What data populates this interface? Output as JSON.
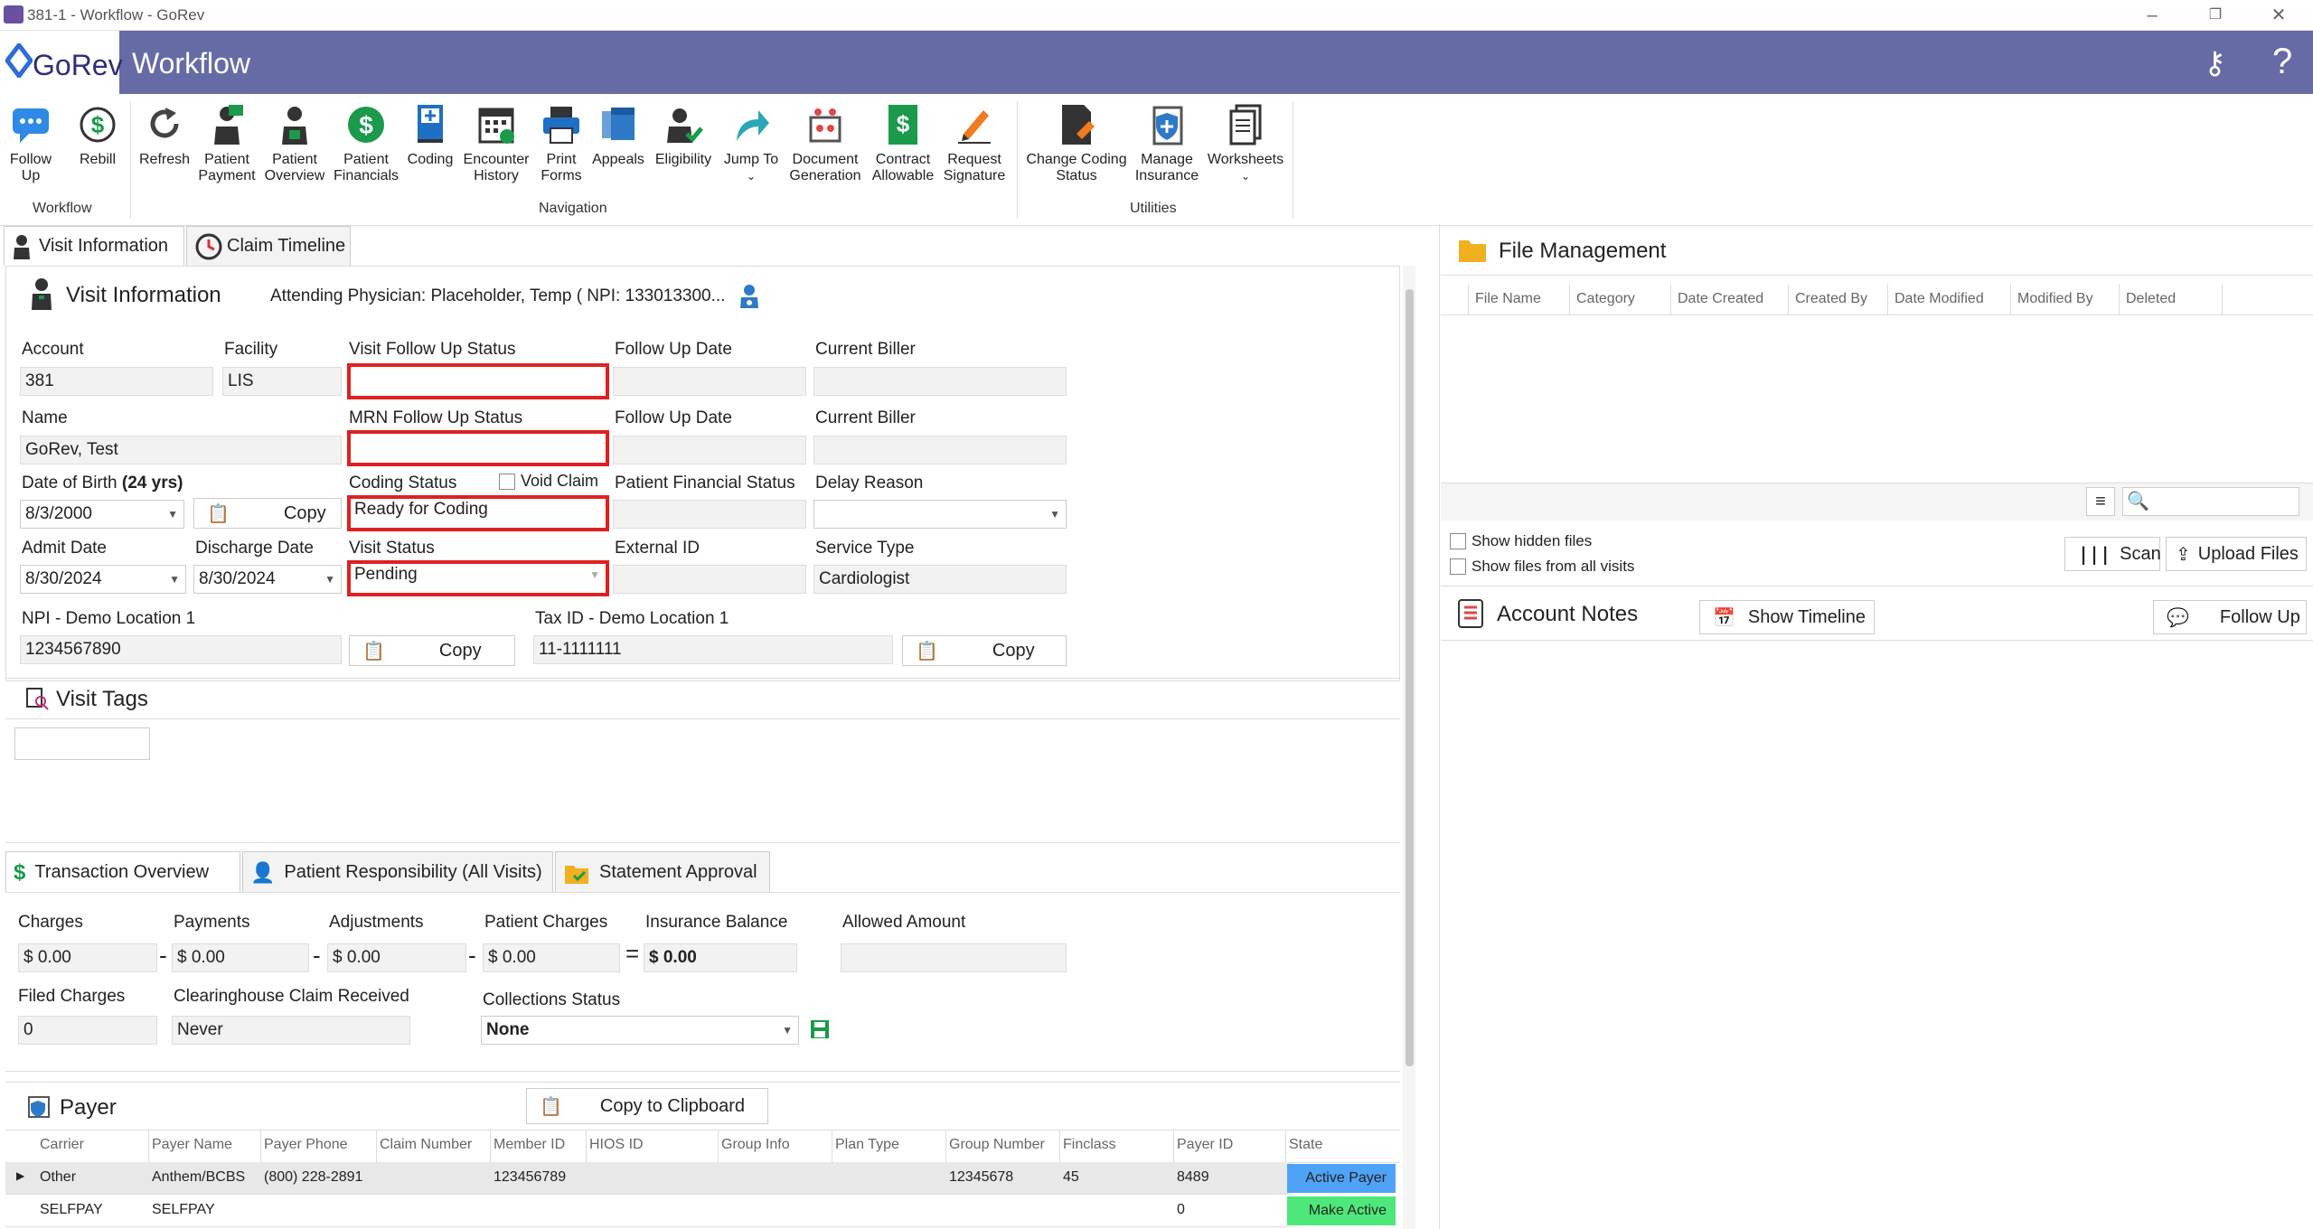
{
  "window": {
    "title": "381-1 - Workflow - GoRev"
  },
  "header": {
    "brand": "GoRev",
    "title": "Workflow"
  },
  "ribbon": {
    "groups": {
      "workflow": "Workflow",
      "navigation": "Navigation",
      "utilities": "Utilities"
    },
    "buttons": {
      "follow_up": "Follow Up",
      "rebill": "Rebill",
      "refresh": "Refresh",
      "patient_payment": "Patient Payment",
      "patient_overview": "Patient Overview",
      "patient_financials": "Patient Financials",
      "coding": "Coding",
      "encounter_history": "Encounter History",
      "print_forms": "Print Forms",
      "appeals": "Appeals",
      "eligibility": "Eligibility",
      "jump_to": "Jump To",
      "document_generation": "Document Generation",
      "contract_allowable": "Contract Allowable",
      "request_signature": "Request Signature",
      "change_coding_status": "Change Coding Status",
      "manage_insurance": "Manage Insurance",
      "worksheets": "Worksheets"
    }
  },
  "tabs": {
    "visit_information": "Visit Information",
    "claim_timeline": "Claim Timeline"
  },
  "visit": {
    "title": "Visit Information",
    "attending": "Attending Physician: Placeholder, Temp ( NPI: 133013300...",
    "labels": {
      "account": "Account",
      "facility": "Facility",
      "visit_follow_up_status": "Visit Follow Up Status",
      "follow_up_date": "Follow Up Date",
      "current_biller": "Current Biller",
      "name": "Name",
      "mrn_follow_up_status": "MRN Follow Up Status",
      "dob": "Date of Birth",
      "dob_age": "(24 yrs)",
      "coding_status": "Coding Status",
      "void_claim": "Void Claim",
      "patient_financial_status": "Patient Financial Status",
      "delay_reason": "Delay Reason",
      "admit_date": "Admit Date",
      "discharge_date": "Discharge Date",
      "visit_status": "Visit Status",
      "external_id": "External ID",
      "service_type": "Service Type",
      "npi": "NPI - Demo Location 1",
      "tax_id": "Tax ID - Demo Location 1",
      "copy": "Copy"
    },
    "values": {
      "account": "381",
      "facility": "LIS",
      "visit_follow_up_status": "",
      "follow_up_date": "",
      "current_biller": "",
      "name": "GoRev, Test",
      "mrn_follow_up_status": "",
      "dob": "8/3/2000",
      "coding_status": "Ready for Coding",
      "admit_date": "8/30/2024",
      "discharge_date": "8/30/2024",
      "visit_status": "Pending",
      "external_id": "",
      "service_type": "Cardiologist",
      "npi": "1234567890",
      "tax_id": "11-1111111"
    }
  },
  "tags": {
    "title": "Visit Tags"
  },
  "txn_tabs": {
    "overview": "Transaction Overview",
    "responsibility": "Patient Responsibility (All Visits)",
    "statement": "Statement Approval"
  },
  "txn": {
    "labels": {
      "charges": "Charges",
      "payments": "Payments",
      "adjustments": "Adjustments",
      "patient_charges": "Patient Charges",
      "insurance_balance": "Insurance Balance",
      "allowed_amount": "Allowed Amount",
      "filed_charges": "Filed Charges",
      "clearinghouse": "Clearinghouse Claim Received",
      "collections_status": "Collections Status"
    },
    "values": {
      "charges": "$ 0.00",
      "payments": "$ 0.00",
      "adjustments": "$ 0.00",
      "patient_charges": "$ 0.00",
      "insurance_balance": "$ 0.00",
      "allowed_amount": "",
      "filed_charges": "0",
      "clearinghouse": "Never",
      "collections_status": "None"
    },
    "ops": {
      "minus": "-",
      "equals": "="
    }
  },
  "payer": {
    "title": "Payer",
    "copy_label": "Copy to Clipboard",
    "columns": [
      "Carrier",
      "Payer Name",
      "Payer Phone",
      "Claim Number",
      "Member ID",
      "HIOS ID",
      "Group Info",
      "Plan Type",
      "Group Number",
      "Finclass",
      "Payer ID",
      "State"
    ],
    "rows": [
      [
        "Other",
        "Anthem/BCBS",
        "(800) 228-2891",
        "",
        "123456789",
        "",
        "",
        "",
        "12345678",
        "45",
        "8489",
        "Active Payer"
      ],
      [
        "SELFPAY",
        "SELFPAY",
        "",
        "",
        "",
        "",
        "",
        "",
        "",
        "",
        "0",
        "Make Active"
      ]
    ],
    "state_colors": {
      "active": "#4fa3f7",
      "make_active": "#4ee87a"
    }
  },
  "files": {
    "title": "File Management",
    "columns": [
      "File Name",
      "Category",
      "Date Created",
      "Created By",
      "Date Modified",
      "Modified By",
      "Deleted"
    ],
    "show_hidden": "Show hidden files",
    "show_all": "Show files from all visits",
    "scan": "Scan",
    "upload": "Upload Files"
  },
  "notes": {
    "title": "Account Notes",
    "show_timeline": "Show Timeline",
    "follow_up": "Follow Up"
  }
}
